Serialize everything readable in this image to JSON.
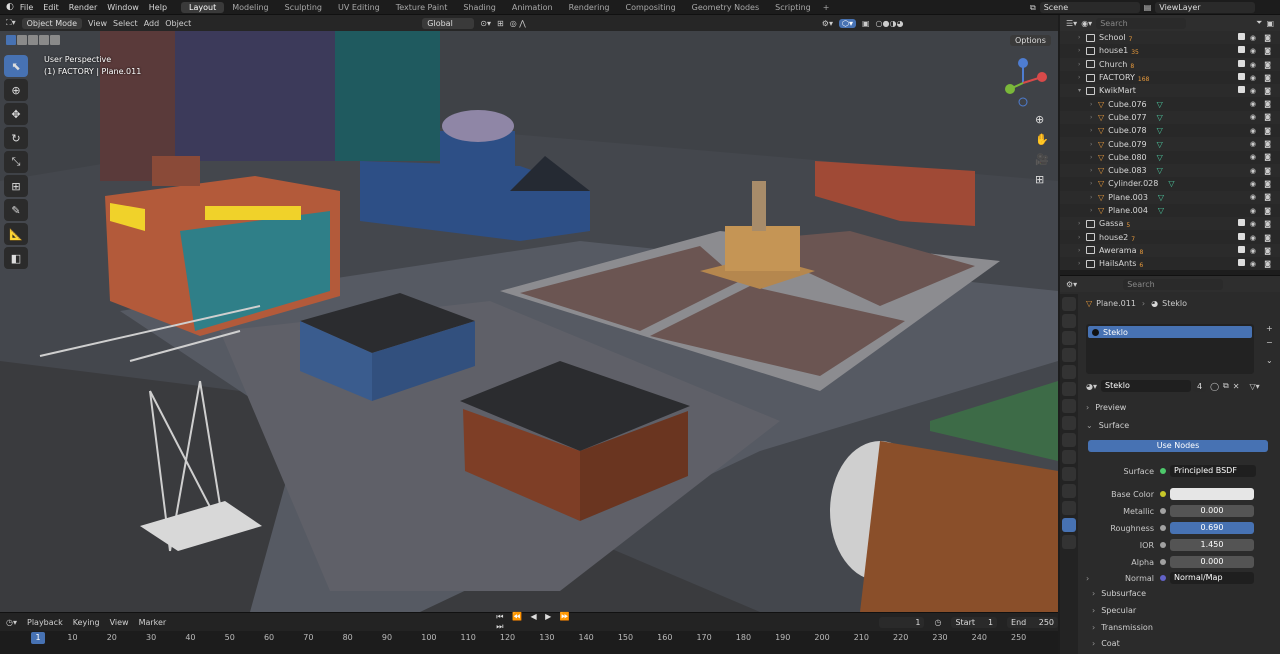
{
  "menu": [
    "File",
    "Edit",
    "Render",
    "Window",
    "Help"
  ],
  "workspaces": [
    "Layout",
    "Modeling",
    "Sculpting",
    "UV Editing",
    "Texture Paint",
    "Shading",
    "Animation",
    "Rendering",
    "Compositing",
    "Geometry Nodes",
    "Scripting"
  ],
  "active_workspace": "Layout",
  "scene": {
    "scene_name": "Scene",
    "view_layer": "ViewLayer"
  },
  "viewport_header": {
    "mode": "Object Mode",
    "menus": [
      "View",
      "Select",
      "Add",
      "Object"
    ],
    "orientation": "Global",
    "options": "Options"
  },
  "viewport_overlay": {
    "perspective": "User Perspective",
    "object": "(1) FACTORY | Plane.011"
  },
  "outliner": {
    "search_placeholder": "Search",
    "rows": [
      {
        "label": "School",
        "badge": "7",
        "child": false
      },
      {
        "label": "house1",
        "badge": "35",
        "child": false
      },
      {
        "label": "Church",
        "badge": "8",
        "child": false
      },
      {
        "label": "FACTORY",
        "badge": "168",
        "child": false
      },
      {
        "label": "KwikMart",
        "badge": "",
        "child": false
      },
      {
        "label": "Cube.076",
        "badge": "",
        "child": true
      },
      {
        "label": "Cube.077",
        "badge": "",
        "child": true
      },
      {
        "label": "Cube.078",
        "badge": "",
        "child": true
      },
      {
        "label": "Cube.079",
        "badge": "",
        "child": true
      },
      {
        "label": "Cube.080",
        "badge": "",
        "child": true
      },
      {
        "label": "Cube.083",
        "badge": "",
        "child": true
      },
      {
        "label": "Cylinder.028",
        "badge": "",
        "child": true
      },
      {
        "label": "Plane.003",
        "badge": "",
        "child": true
      },
      {
        "label": "Plane.004",
        "badge": "",
        "child": true
      },
      {
        "label": "Gassa",
        "badge": "5",
        "child": false
      },
      {
        "label": "house2",
        "badge": "7",
        "child": false
      },
      {
        "label": "Awerama",
        "badge": "8",
        "child": false
      },
      {
        "label": "HailsAnts",
        "badge": "6",
        "child": false
      }
    ]
  },
  "properties": {
    "search_placeholder": "Search",
    "breadcrumb_object": "Plane.011",
    "breadcrumb_material": "Steklo",
    "slot": "Steklo",
    "material_name": "Steklo",
    "users": "4",
    "preview": "Preview",
    "surface_section": "Surface",
    "use_nodes": "Use Nodes",
    "surface_label": "Surface",
    "surface_value": "Principled BSDF",
    "base_color_label": "Base Color",
    "metallic_label": "Metallic",
    "metallic": "0.000",
    "roughness_label": "Roughness",
    "roughness": "0.690",
    "ior_label": "IOR",
    "ior": "1.450",
    "alpha_label": "Alpha",
    "alpha": "0.000",
    "normal_label": "Normal",
    "normal_value": "Normal/Map",
    "subsections": [
      "Subsurface",
      "Specular",
      "Transmission",
      "Coat"
    ]
  },
  "timeline": {
    "menus": [
      "Playback",
      "Keying",
      "View",
      "Marker"
    ],
    "current_frame": "1",
    "start_label": "Start",
    "start": "1",
    "end_label": "End",
    "end": "250",
    "ticks": [
      "1",
      "10",
      "20",
      "30",
      "40",
      "50",
      "60",
      "70",
      "80",
      "90",
      "100",
      "110",
      "120",
      "130",
      "140",
      "150",
      "160",
      "170",
      "180",
      "190",
      "200",
      "210",
      "220",
      "230",
      "240",
      "250"
    ]
  },
  "colors": {
    "accent": "#4772b3",
    "base_color": "#e6e6e6"
  }
}
